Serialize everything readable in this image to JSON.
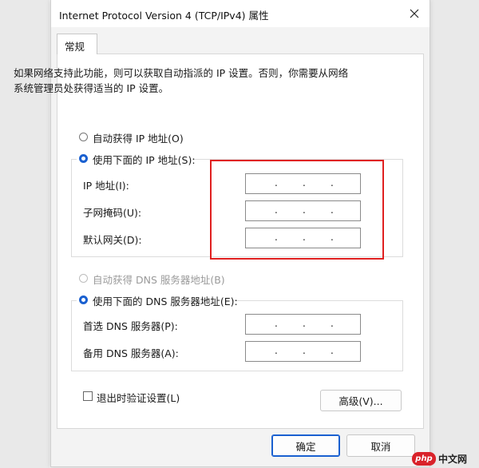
{
  "window": {
    "title": "Internet Protocol Version 4 (TCP/IPv4) 属性",
    "close_glyph": "✕"
  },
  "tabs": [
    {
      "label": "常规"
    }
  ],
  "description": "如果网络支持此功能，则可以获取自动指派的 IP 设置。否则，你需要从网络系统管理员处获得适当的 IP 设置。",
  "ip_section": {
    "auto_option": {
      "label": "自动获得 IP 地址(O)",
      "selected": false
    },
    "manual_option": {
      "label": "使用下面的 IP 地址(S):",
      "selected": true
    },
    "fields": [
      {
        "label": "IP 地址(I):",
        "value": ". . ."
      },
      {
        "label": "子网掩码(U):",
        "value": ". . ."
      },
      {
        "label": "默认网关(D):",
        "value": ". . ."
      }
    ]
  },
  "dns_section": {
    "auto_option": {
      "label": "自动获得 DNS 服务器地址(B)",
      "selected": false,
      "disabled": true
    },
    "manual_option": {
      "label": "使用下面的 DNS 服务器地址(E):",
      "selected": true
    },
    "fields": [
      {
        "label": "首选 DNS 服务器(P):",
        "value": ". . ."
      },
      {
        "label": "备用 DNS 服务器(A):",
        "value": ". . ."
      }
    ]
  },
  "validate_checkbox": {
    "label": "退出时验证设置(L)",
    "checked": false
  },
  "buttons": {
    "advanced": "高级(V)...",
    "ok": "确定",
    "cancel": "取消"
  },
  "watermark": {
    "badge": "php",
    "text": "中文网"
  },
  "colors": {
    "accent": "#1a60d0",
    "highlight_border": "#e02020"
  }
}
